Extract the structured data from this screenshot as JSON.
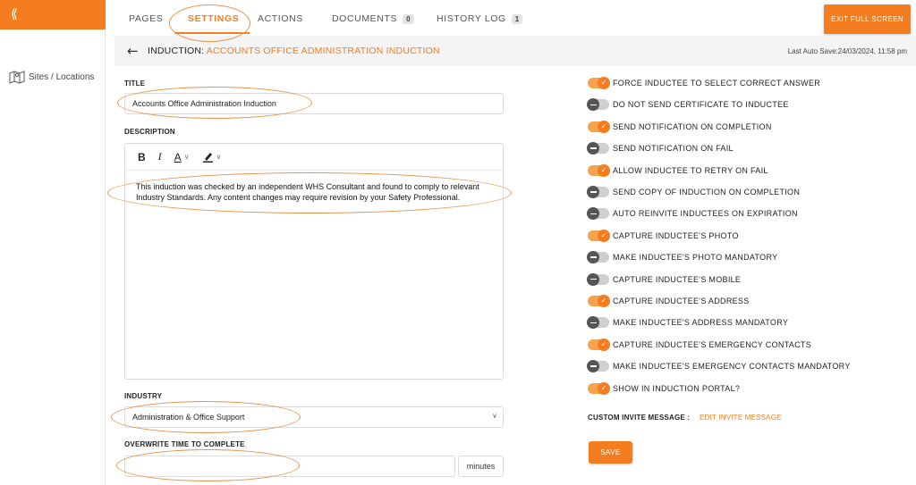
{
  "sidebar": {
    "collapse_icon": "double-chevron-left-icon",
    "items": [
      {
        "label": "Sites / Locations",
        "icon": "map-icon"
      }
    ]
  },
  "tabs": [
    {
      "label": "PAGES",
      "active": false
    },
    {
      "label": "SETTINGS",
      "active": true
    },
    {
      "label": "ACTIONS",
      "active": false
    },
    {
      "label": "DOCUMENTS",
      "badge": "0",
      "active": false
    },
    {
      "label": "HISTORY LOG",
      "badge": "1",
      "active": false
    }
  ],
  "toolbar": {
    "exit_label": "EXIT FULL SCREEN"
  },
  "header": {
    "prefix": "INDUCTION: ",
    "name": "ACCOUNTS OFFICE ADMINISTRATION INDUCTION",
    "autosave": "Last Auto Save:24/03/2024, 11:58 pm"
  },
  "form": {
    "title_label": "TITLE",
    "title_value": "Accounts Office Administration Induction",
    "description_label": "DESCRIPTION",
    "editor_buttons": {
      "bold": "B",
      "italic": "I",
      "text_color": "A"
    },
    "description_text": "This induction was checked by an independent WHS Consultant and found to comply to relevant Industry Standards. Any content changes may require revision by your Safety Professional.",
    "industry_label": "INDUSTRY",
    "industry_value": "Administration & Office Support",
    "overwrite_label": "OVERWRITE TIME TO COMPLETE",
    "overwrite_value": "",
    "minutes_label": "minutes"
  },
  "settings": [
    {
      "label": "FORCE INDUCTEE TO SELECT CORRECT ANSWER",
      "on": true
    },
    {
      "label": "DO NOT SEND CERTIFICATE TO INDUCTEE",
      "on": false
    },
    {
      "label": "SEND NOTIFICATION ON COMPLETION",
      "on": true
    },
    {
      "label": "SEND NOTIFICATION ON FAIL",
      "on": false
    },
    {
      "label": "ALLOW INDUCTEE TO RETRY ON FAIL",
      "on": true
    },
    {
      "label": "SEND COPY OF INDUCTION ON COMPLETION",
      "on": false
    },
    {
      "label": "AUTO REINVITE INDUCTEES ON EXPIRATION",
      "on": false
    },
    {
      "label": "CAPTURE INDUCTEE'S PHOTO",
      "on": true
    },
    {
      "label": "MAKE INDUCTEE'S PHOTO MANDATORY",
      "on": false
    },
    {
      "label": "CAPTURE INDUCTEE'S MOBILE",
      "on": false
    },
    {
      "label": "CAPTURE INDUCTEE'S ADDRESS",
      "on": true
    },
    {
      "label": "MAKE INDUCTEE'S ADDRESS MANDATORY",
      "on": false
    },
    {
      "label": "CAPTURE INDUCTEE'S EMERGENCY CONTACTS",
      "on": true
    },
    {
      "label": "MAKE INDUCTEE'S EMERGENCY CONTACTS MANDATORY",
      "on": false
    },
    {
      "label": "SHOW IN INDUCTION PORTAL?",
      "on": true
    }
  ],
  "custom_invite": {
    "label": "CUSTOM INVITE MESSAGE :",
    "link": "EDIT INVITE MESSAGE"
  },
  "save_label": "SAVE",
  "colors": {
    "accent": "#f47d20",
    "annotation": "#e8924a",
    "toggle_off": "#555555"
  }
}
